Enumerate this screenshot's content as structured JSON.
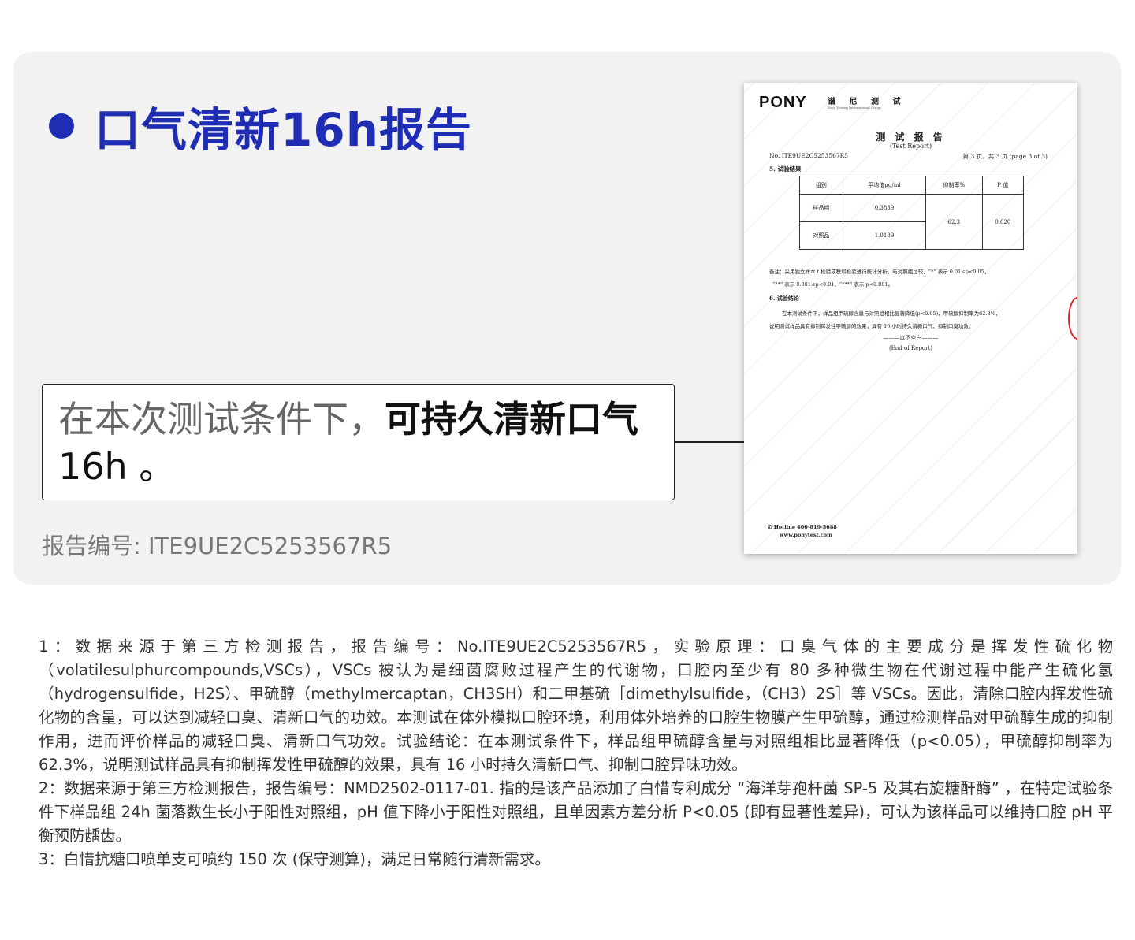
{
  "title": "口气清新16h报告",
  "claim": {
    "normal": "在本次测试条件下，",
    "bold": "可持久清新口气",
    "line2": "16h 。"
  },
  "report_number": "报告编号: ITE9UE2C5253567R5",
  "document": {
    "brand": "PONY",
    "brand_cn": "谱 尼 测 试",
    "brand_en": "Pony Testing International Group",
    "title": "测 试 报 告",
    "subtitle": "(Test Report)",
    "number": "No. ITE9UE2C5253567R5",
    "page": "第 3 页，共 3 页 (page 3 of 3)",
    "section5": "5. 试验结果",
    "table": {
      "headers": [
        "组别",
        "平均值μg/ml",
        "抑制率%",
        "P 值"
      ],
      "rows": [
        [
          "样品组",
          "0.3839"
        ],
        [
          "对照品",
          "1.0189"
        ]
      ],
      "rate": "62.3",
      "p": "0.020"
    },
    "note1": "备注：采用独立样本 t 检验或秩和检验进行统计分析，与对照组比较，“*” 表示 0.01≤p<0.05，",
    "note2": "“**” 表示 0.001≤p<0.01，“***” 表示 p<0.001。",
    "section6": "6. 试验结论",
    "conclusion1": "在本测试条件下，样品组甲硫醇含量与对照组相比显著降低(p<0.05)，甲硫醇抑制率为62.3%，",
    "conclusion2": "说明测试样品具有抑制挥发性甲硫醇的效果，具有 16 小时持久清新口气、抑制口臭功效。",
    "end_cn": "———以下空白———",
    "end_en": "(End of Report)",
    "hotline": "✆ Hotline 400-819-5688",
    "website": "www.ponytest.com"
  },
  "notes": [
    "1：数据来源于第三方检测报告，报告编号：No.ITE9UE2C5253567R5，实验原理：口臭气体的主要成分是挥发性硫化物（volatilesulphurcompounds,VSCs），VSCs 被认为是细菌腐败过程产生的代谢物，口腔内至少有 80 多种微生物在代谢过程中能产生硫化氢（hydrogensulfide，H2S）、甲硫醇（methylmercaptan，CH3SH）和二甲基硫［dimethylsulfide，（CH3）2S］等 VSCs。因此，清除口腔内挥发性硫化物的含量，可以达到减轻口臭、清新口气的功效。本测试在体外模拟口腔环境，利用体外培养的口腔生物膜产生甲硫醇，通过检测样品对甲硫醇生成的抑制作用，进而评价样品的减轻口臭、清新口气功效。试验结论：在本测试条件下，样品组甲硫醇含量与对照组相比显著降低（p<0.05），甲硫醇抑制率为 62.3%，说明测试样品具有抑制挥发性甲硫醇的效果，具有 16 小时持久清新口气、抑制口腔异味功效。",
    "2：数据来源于第三方检测报告，报告编号：NMD2502-0117-01. 指的是该产品添加了白惜专利成分 “海洋芽孢杆菌 SP-5 及其右旋糖酐酶” ，在特定试验条件下样品组 24h 菌落数生长小于阳性对照组，pH 值下降小于阳性对照组，且单因素方差分析 P<0.05 (即有显著性差异)，可认为该样品可以维持口腔 pH 平衡预防龋齿。",
    "3：白惜抗糖口喷单支可喷约 150 次 (保守测算)，满足日常随行清新需求。"
  ]
}
